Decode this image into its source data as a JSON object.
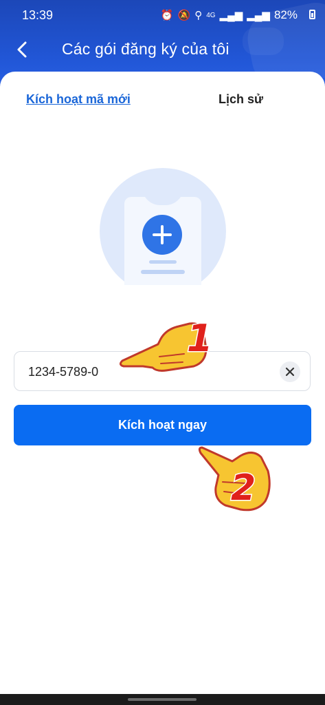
{
  "status_bar": {
    "time": "13:39",
    "network": "4G",
    "battery": "82%"
  },
  "header": {
    "title": "Các gói đăng ký của tôi"
  },
  "tabs": {
    "new_code": "Kích hoạt mã mới",
    "history": "Lịch sử"
  },
  "code_input": {
    "value": "1234-5789-0"
  },
  "activate_button": {
    "label": "Kích hoạt ngay"
  },
  "annotations": {
    "step1": "1",
    "step2": "2"
  },
  "colors": {
    "primary": "#0a6cf2",
    "header_bg": "#1f4fc4",
    "link": "#1a66d8",
    "annotation_number": "#e0211b",
    "hand": "#f7c531"
  }
}
